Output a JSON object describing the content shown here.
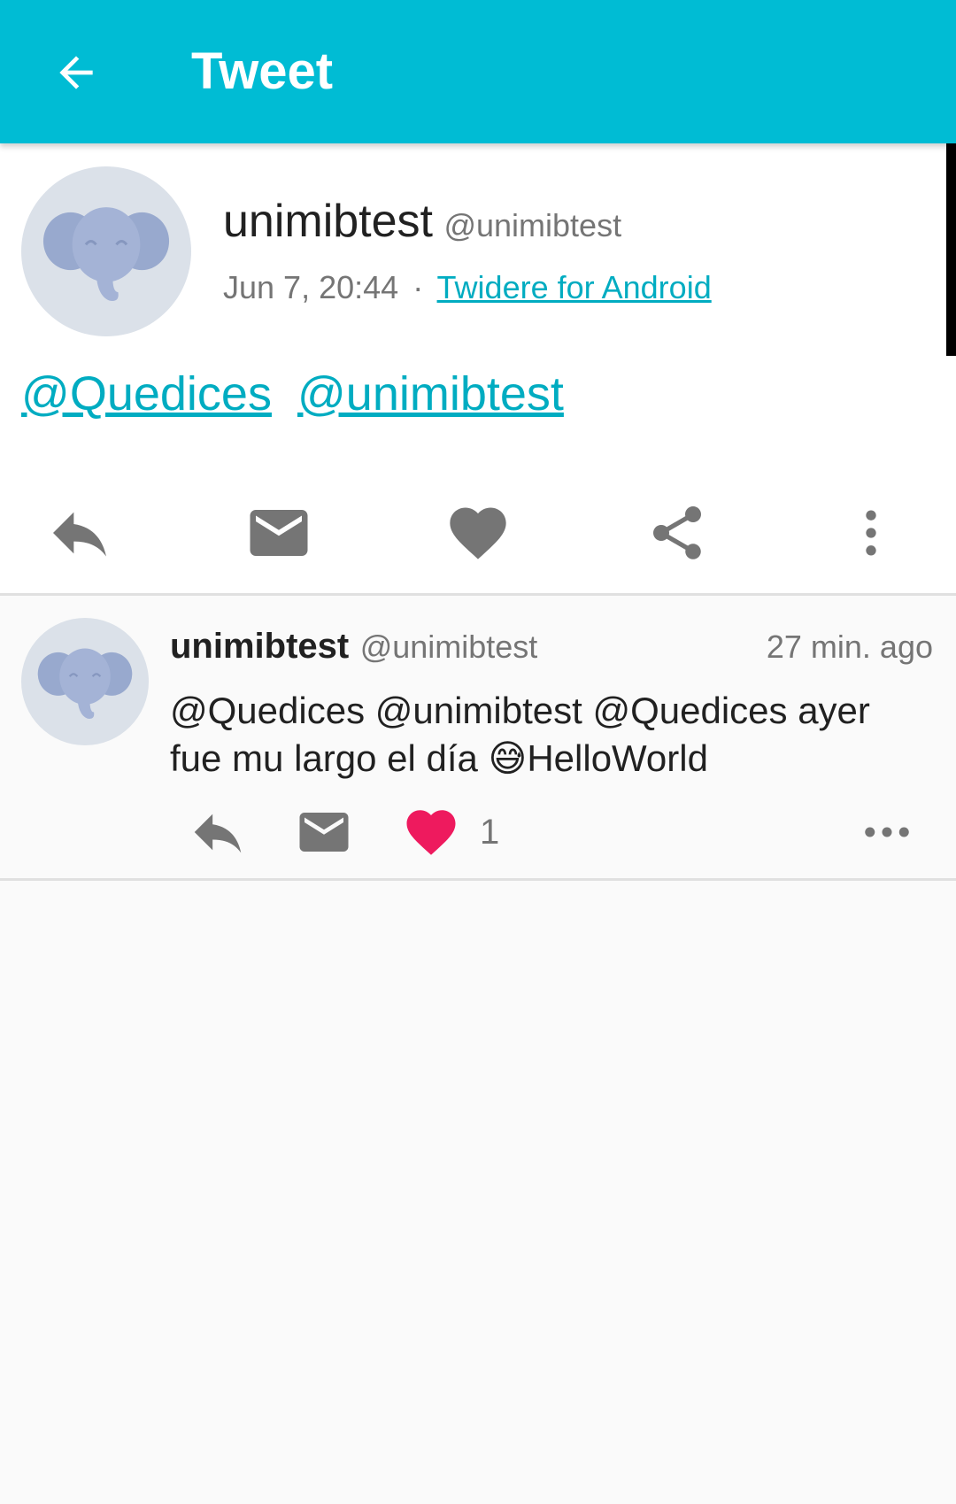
{
  "appbar": {
    "title": "Tweet",
    "color": "#00bcd4"
  },
  "detail": {
    "avatar_icon": "elephant-icon",
    "name": "unimibtest",
    "handle": "@unimibtest",
    "time": "Jun 7, 20:44",
    "separator": "·",
    "source": "Twidere for Android",
    "mentions": [
      "@Quedices",
      "@unimibtest"
    ],
    "actions": [
      "reply-icon",
      "message-icon",
      "heart-icon",
      "share-icon",
      "more-vert-icon"
    ]
  },
  "reply": {
    "avatar_icon": "elephant-icon",
    "name": "unimibtest",
    "handle": "@unimibtest",
    "time": "27 min. ago",
    "text_line1": "@Quedices @unimibtest @Quedices  ayer",
    "text_line2_before": "fue mu largo el día ",
    "emoji": "😅",
    "text_line2_after": "HelloWorld",
    "like_count": "1",
    "like_color": "#ee1a5e",
    "actions": [
      "reply-icon",
      "message-icon",
      "heart-icon",
      "more-horiz-icon"
    ]
  }
}
